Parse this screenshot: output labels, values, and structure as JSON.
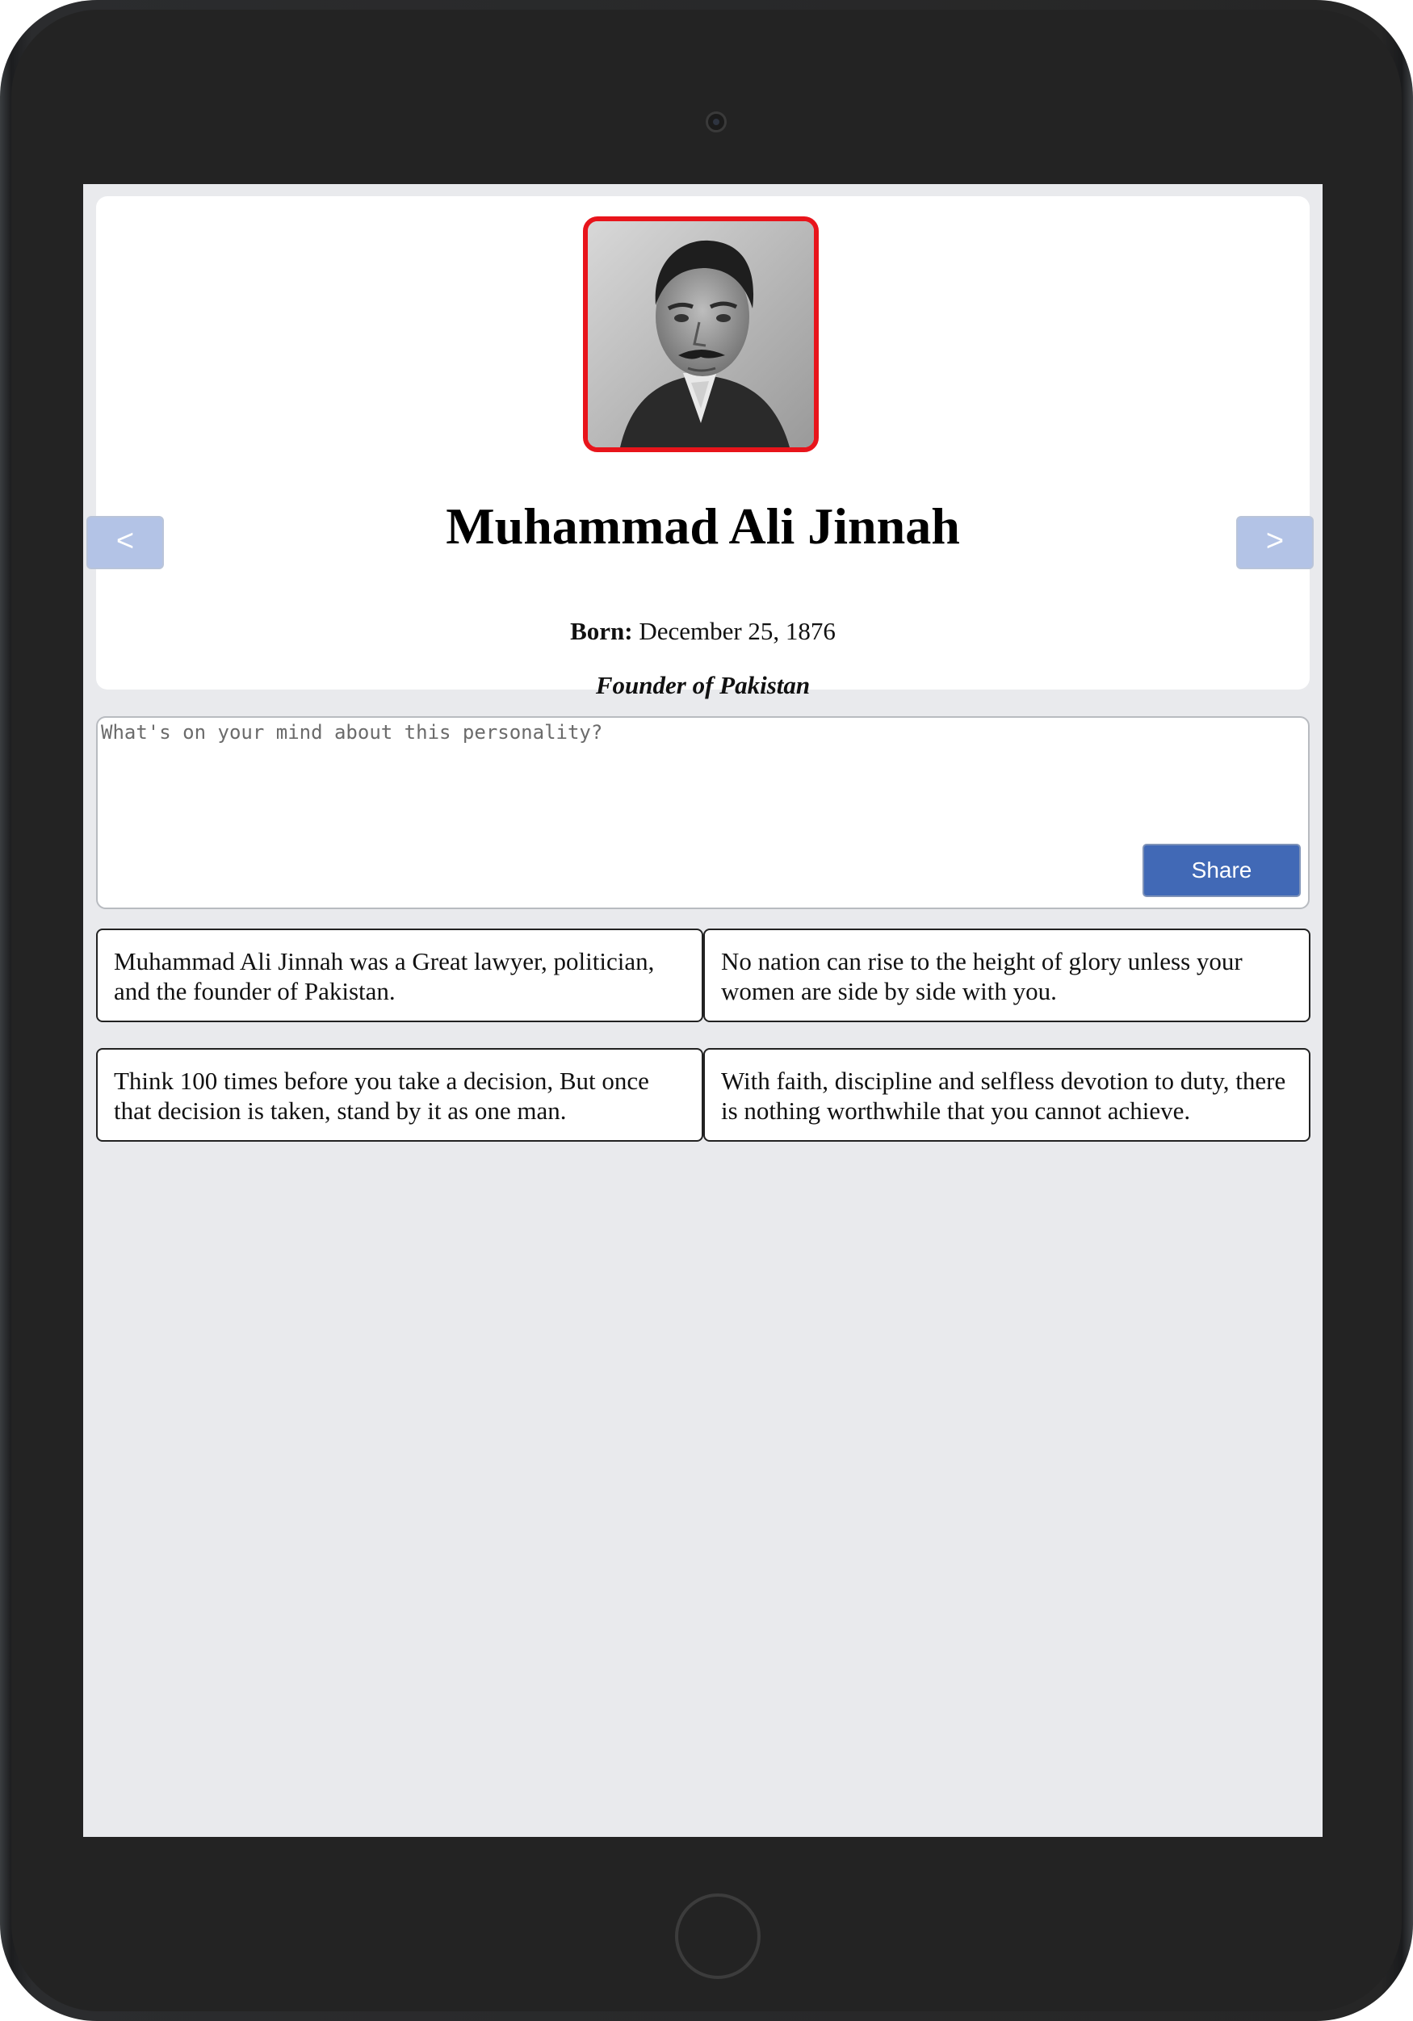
{
  "profile": {
    "name": "Muhammad Ali Jinnah",
    "born_label": "Born:",
    "born_date": "December 25, 1876",
    "role": "Founder of Pakistan"
  },
  "nav": {
    "prev_label": "<",
    "next_label": ">"
  },
  "composer": {
    "placeholder": "What's on your mind about this personality?",
    "value": "",
    "share_label": "Share"
  },
  "posts": [
    "Muhammad Ali Jinnah was a Great lawyer, politician, and the founder of Pakistan.",
    "No nation can rise to the height of glory unless your women are side by side with you.",
    "Think 100 times before you take a decision, But once that decision is taken, stand by it as one man.",
    "With faith, discipline and selfless devotion to duty, there is nothing worthwhile that you cannot achieve."
  ],
  "colors": {
    "screen_background": "#e9eaed",
    "portrait_border": "#e8141b",
    "share_button": "#4169b6",
    "nav_button": "#b3c3e6"
  }
}
